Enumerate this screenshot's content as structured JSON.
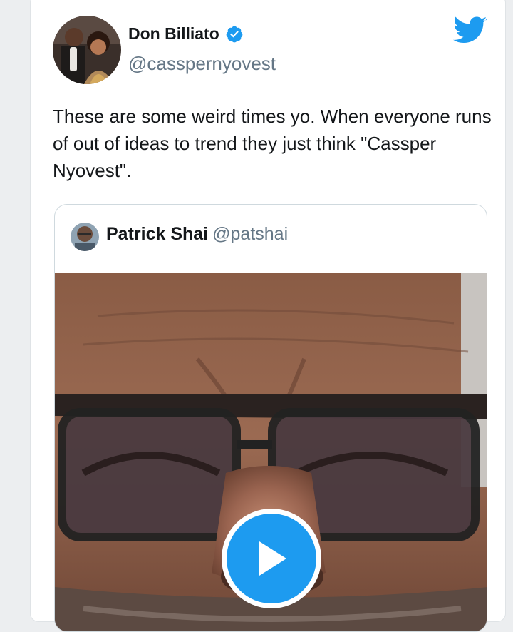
{
  "tweet": {
    "author": {
      "display_name": "Don Billiato",
      "handle": "@casspernyovest",
      "verified": true,
      "avatar_icon": "user-avatar-photo"
    },
    "text": "These are some weird times yo. When everyone runs of out of ideas to trend they just think \"Cassper Nyovest\".",
    "brand_icon": "twitter-bird-icon",
    "quoted_tweet": {
      "display_name": "Patrick Shai",
      "handle": "@patshai",
      "avatar_icon": "user-avatar-photo",
      "media": {
        "type": "video",
        "play_icon": "play-icon"
      }
    }
  },
  "colors": {
    "accent": "#1d9bf0",
    "text": "#14171a",
    "muted": "#657786",
    "border": "#cfd9de",
    "page_bg": "#eceef0"
  }
}
